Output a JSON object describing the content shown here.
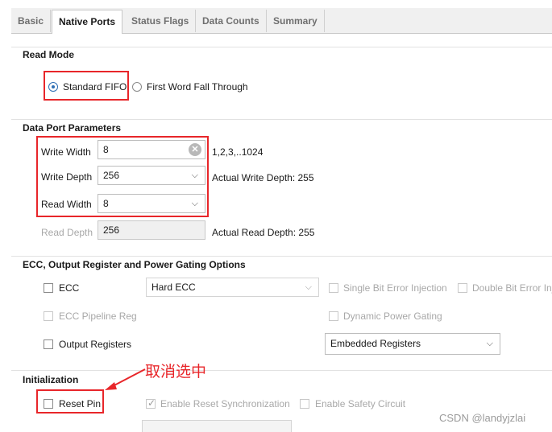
{
  "tabs": [
    {
      "label": "Basic"
    },
    {
      "label": "Native Ports"
    },
    {
      "label": "Status Flags"
    },
    {
      "label": "Data Counts"
    },
    {
      "label": "Summary"
    }
  ],
  "read_mode": {
    "title": "Read Mode",
    "option_standard": "Standard FIFO",
    "option_fwft": "First Word Fall Through",
    "selected": "Standard FIFO"
  },
  "data_port": {
    "title": "Data Port Parameters",
    "write_width_label": "Write Width",
    "write_width_value": "8",
    "write_width_range": "1,2,3,..1024",
    "write_depth_label": "Write Depth",
    "write_depth_value": "256",
    "actual_write_depth": "Actual Write Depth: 255",
    "read_width_label": "Read Width",
    "read_width_value": "8",
    "read_depth_label": "Read Depth",
    "read_depth_value": "256",
    "actual_read_depth": "Actual Read Depth: 255"
  },
  "ecc": {
    "title": "ECC, Output Register and Power Gating Options",
    "ecc_label": "ECC",
    "ecc_select": "Hard ECC",
    "single_bit": "Single Bit Error Injection",
    "double_bit": "Double Bit Error Inj",
    "ecc_pipeline": "ECC Pipeline Reg",
    "dynamic_power": "Dynamic Power Gating",
    "output_registers": "Output Registers",
    "output_select": "Embedded Registers"
  },
  "init": {
    "title": "Initialization",
    "reset_pin": "Reset Pin",
    "enable_reset_sync": "Enable Reset Synchronization",
    "enable_safety": "Enable Safety Circuit"
  },
  "annotation": {
    "text": "取消选中",
    "color": "#e8262a"
  },
  "watermark": "CSDN @landyjzlai",
  "colors": {
    "accent": "#2f6fb5",
    "highlight": "#e8262a"
  }
}
